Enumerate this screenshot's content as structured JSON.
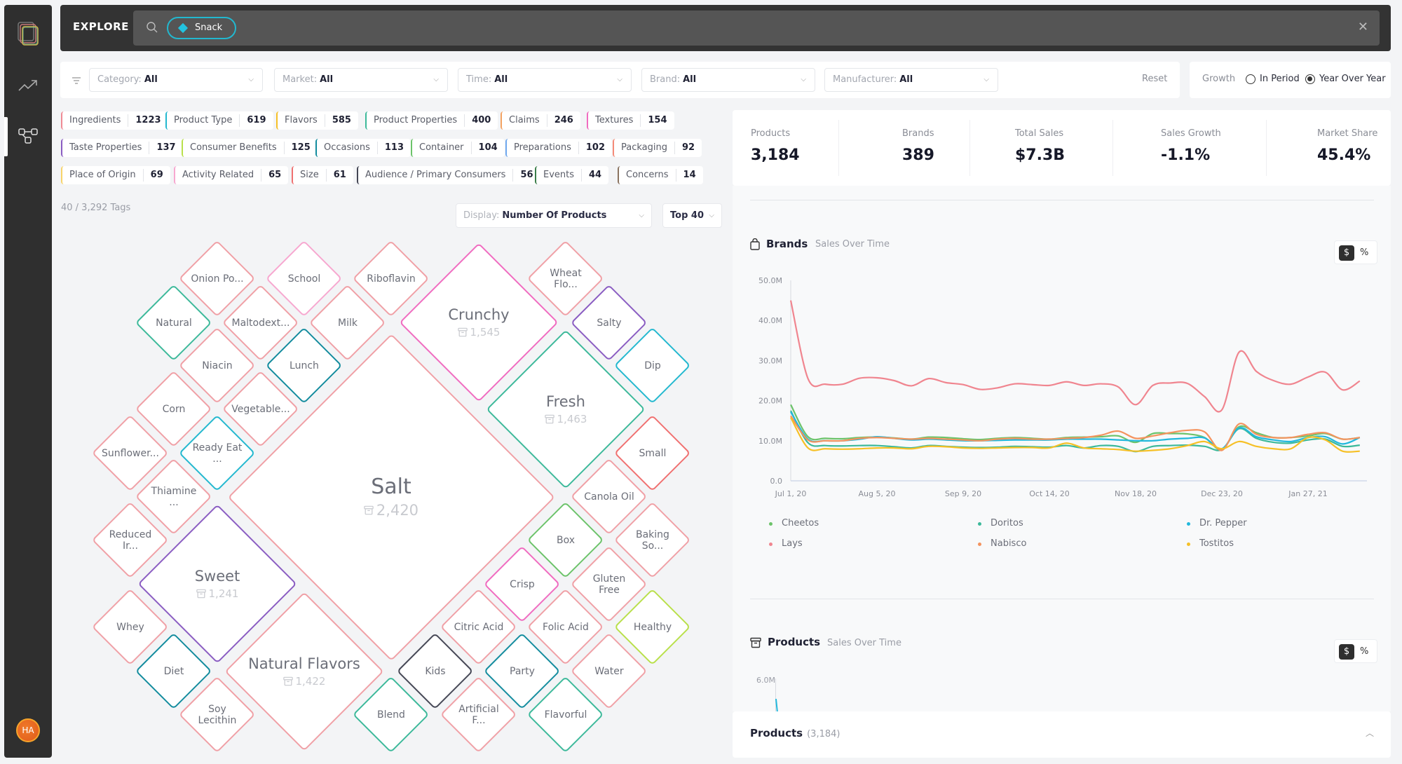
{
  "sidebar": {
    "items": [
      {
        "icon": "layers-logo-icon",
        "label": "Home"
      },
      {
        "icon": "trend-icon",
        "label": "Trends"
      },
      {
        "icon": "network-icon",
        "label": "Explore",
        "active": true
      }
    ],
    "avatar_initials": "HA"
  },
  "explore": {
    "title": "EXPLORE",
    "chip_label": "Snack",
    "close_icon": "close-icon"
  },
  "filters": {
    "selects": [
      {
        "label": "Category:",
        "value": "All"
      },
      {
        "label": "Market:",
        "value": "All"
      },
      {
        "label": "Time:",
        "value": "All"
      },
      {
        "label": "Brand:",
        "value": "All"
      },
      {
        "label": "Manufacturer:",
        "value": "All"
      }
    ],
    "reset_label": "Reset"
  },
  "growth": {
    "label": "Growth",
    "options": [
      {
        "label": "In Period",
        "selected": false
      },
      {
        "label": "Year Over Year",
        "selected": true
      }
    ]
  },
  "tag_categories": [
    {
      "name": "Ingredients",
      "count": "1223",
      "color": "#f08a94"
    },
    {
      "name": "Product Type",
      "count": "619",
      "color": "#22b8cf"
    },
    {
      "name": "Flavors",
      "count": "585",
      "color": "#f6c026"
    },
    {
      "name": "Product Properties",
      "count": "400",
      "color": "#3cb99a"
    },
    {
      "name": "Claims",
      "count": "246",
      "color": "#f4a261"
    },
    {
      "name": "Textures",
      "count": "154",
      "color": "#f06bc0"
    },
    {
      "name": "Taste Properties",
      "count": "137",
      "color": "#8a5cc2"
    },
    {
      "name": "Consumer Benefits",
      "count": "125",
      "color": "#b9e04a"
    },
    {
      "name": "Occasions",
      "count": "113",
      "color": "#138c9e"
    },
    {
      "name": "Container",
      "count": "104",
      "color": "#6cc36a"
    },
    {
      "name": "Preparations",
      "count": "102",
      "color": "#6fa8ee"
    },
    {
      "name": "Packaging",
      "count": "92",
      "color": "#f58b78"
    },
    {
      "name": "Place of Origin",
      "count": "69",
      "color": "#f8d46a"
    },
    {
      "name": "Activity Related",
      "count": "65",
      "color": "#f7a8d0"
    },
    {
      "name": "Size",
      "count": "61",
      "color": "#f07070"
    },
    {
      "name": "Audience / Primary Consumers",
      "count": "56",
      "color": "#444654"
    },
    {
      "name": "Events",
      "count": "44",
      "color": "#3a7d4a"
    },
    {
      "name": "Concerns",
      "count": "14",
      "color": "#8a7360"
    }
  ],
  "tag_counter": "40 / 3,292 Tags",
  "display": {
    "label": "Display:",
    "value": "Number Of Products"
  },
  "top": {
    "value": "Top 40"
  },
  "tags": [
    {
      "name": "Salt",
      "count": "2,420",
      "color": "#f0a0a6"
    },
    {
      "name": "Crunchy",
      "count": "1,545",
      "color": "#f06bc0"
    },
    {
      "name": "Fresh",
      "count": "1,463",
      "color": "#3cb99a"
    },
    {
      "name": "Natural Flavors",
      "count": "1,422",
      "color": "#f0a0a6"
    },
    {
      "name": "Sweet",
      "count": "1,241",
      "color": "#8a5cc2"
    },
    {
      "name": "Onion Po...",
      "color": "#f0a0a6"
    },
    {
      "name": "School",
      "color": "#f7a8d0"
    },
    {
      "name": "Riboflavin",
      "color": "#f0a0a6"
    },
    {
      "name": "Wheat Flo...",
      "color": "#f0a0a6"
    },
    {
      "name": "Natural",
      "color": "#3cb99a"
    },
    {
      "name": "Maltodext...",
      "color": "#f0a0a6"
    },
    {
      "name": "Milk",
      "color": "#f0a0a6"
    },
    {
      "name": "Salty",
      "color": "#8a5cc2"
    },
    {
      "name": "Niacin",
      "color": "#f0a0a6"
    },
    {
      "name": "Lunch",
      "color": "#138c9e"
    },
    {
      "name": "Dip",
      "color": "#22b8cf"
    },
    {
      "name": "Corn",
      "color": "#f0a0a6"
    },
    {
      "name": "Vegetable...",
      "color": "#f0a0a6"
    },
    {
      "name": "Sunflower...",
      "color": "#f0a0a6"
    },
    {
      "name": "Ready Eat ...",
      "color": "#22b8cf"
    },
    {
      "name": "Small",
      "color": "#f07070"
    },
    {
      "name": "Thiamine ...",
      "color": "#f0a0a6"
    },
    {
      "name": "Canola Oil",
      "color": "#f0a0a6"
    },
    {
      "name": "Reduced Ir...",
      "color": "#f0a0a6"
    },
    {
      "name": "Box",
      "color": "#6cc36a"
    },
    {
      "name": "Baking So...",
      "color": "#f0a0a6"
    },
    {
      "name": "Crisp",
      "color": "#f06bc0"
    },
    {
      "name": "Gluten Free",
      "color": "#f0a0a6"
    },
    {
      "name": "Whey",
      "color": "#f0a0a6"
    },
    {
      "name": "Citric Acid",
      "color": "#f0a0a6"
    },
    {
      "name": "Folic Acid",
      "color": "#f0a0a6"
    },
    {
      "name": "Healthy",
      "color": "#b9e04a"
    },
    {
      "name": "Diet",
      "color": "#138c9e"
    },
    {
      "name": "Kids",
      "color": "#444654"
    },
    {
      "name": "Party",
      "color": "#138c9e"
    },
    {
      "name": "Water",
      "color": "#f0a0a6"
    },
    {
      "name": "Soy Lecithin",
      "color": "#f0a0a6"
    },
    {
      "name": "Blend",
      "color": "#3cb99a"
    },
    {
      "name": "Artificial F...",
      "color": "#f0a0a6"
    },
    {
      "name": "Flavorful",
      "color": "#3cb99a"
    }
  ],
  "stats": [
    {
      "label": "Products",
      "value": "3,184"
    },
    {
      "label": "Brands",
      "value": "389"
    },
    {
      "label": "Total Sales",
      "value": "$7.3B"
    },
    {
      "label": "Sales Growth",
      "value": "-1.1%"
    },
    {
      "label": "Market Share",
      "value": "45.4%"
    }
  ],
  "brands_chart": {
    "title": "Brands",
    "subtitle": "Sales Over Time",
    "toggle": {
      "dollar": "$",
      "percent": "%",
      "selected": "$"
    }
  },
  "products_chart": {
    "title": "Products",
    "subtitle": "Sales Over Time",
    "toggle": {
      "dollar": "$",
      "percent": "%",
      "selected": "$"
    },
    "visible_ticks": [
      "6.0M"
    ]
  },
  "products_section": {
    "title": "Products",
    "count": "(3,184)"
  },
  "chart_data": {
    "type": "line",
    "title": "Brands Sales Over Time",
    "xlabel": "",
    "ylabel": "",
    "ylim": [
      0,
      50
    ],
    "y_unit": "M",
    "y_ticks": [
      "0.0",
      "10.0M",
      "20.0M",
      "30.0M",
      "40.0M",
      "50.0M"
    ],
    "x_ticks": [
      "Jul 1, 20",
      "Aug 5, 20",
      "Sep 9, 20",
      "Oct 14, 20",
      "Nov 18, 20",
      "Dec 23, 20",
      "Jan 27, 21"
    ],
    "x_interval": "weekly",
    "x_count": 34,
    "legend_position": "bottom",
    "grid": false,
    "series": [
      {
        "name": "Cheetos",
        "color": "#6cc36a",
        "values": [
          19,
          11,
          10.6,
          10.5,
          10.8,
          10.9,
          10.7,
          10.4,
          10.9,
          10.8,
          10.5,
          10.3,
          10.6,
          10.8,
          10.6,
          10.4,
          10.8,
          10.9,
          11.0,
          11.2,
          9.6,
          11.8,
          11.8,
          11.7,
          10.8,
          7.8,
          13.5,
          12.0,
          10.8,
          10.8,
          11.2,
          11.8,
          10.4,
          10.8
        ]
      },
      {
        "name": "Doritos",
        "color": "#3cb99a",
        "values": [
          17.5,
          9.5,
          8.8,
          8.7,
          8.8,
          8.8,
          8.5,
          8.2,
          8.8,
          8.6,
          8.4,
          8.3,
          8.4,
          8.6,
          8.5,
          8.4,
          8.8,
          8.2,
          8.8,
          8.6,
          7.3,
          8.6,
          8.8,
          8.9,
          8.6,
          7.8,
          13.0,
          10.6,
          9.6,
          9.4,
          10.2,
          10.4,
          8.6,
          8.9
        ]
      },
      {
        "name": "Dr. Pepper",
        "color": "#22b8dc",
        "values": [
          17.2,
          10.4,
          10.0,
          10.0,
          10.4,
          11.0,
          10.6,
          10.2,
          10.4,
          10.2,
          10.0,
          10.0,
          10.1,
          10.2,
          10.2,
          10.2,
          10.4,
          10.4,
          10.4,
          10.2,
          10.0,
          10.0,
          10.4,
          10.6,
          10.7,
          8.0,
          13.2,
          11.0,
          10.2,
          9.8,
          10.8,
          11.0,
          9.2,
          10.8
        ]
      },
      {
        "name": "Lays",
        "color": "#f0858f",
        "values": [
          45.0,
          25.5,
          24.1,
          24.1,
          25.6,
          25.7,
          25.0,
          23.7,
          25.5,
          24.5,
          24.0,
          22.8,
          23.2,
          24.2,
          24.0,
          23.8,
          24.7,
          23.8,
          24.2,
          23.4,
          19.0,
          23.8,
          24.4,
          24.3,
          21.0,
          17.7,
          32.1,
          27.3,
          25.0,
          24.1,
          25.9,
          27.1,
          22.7,
          24.9
        ]
      },
      {
        "name": "Nabisco",
        "color": "#f4935e",
        "values": [
          16.2,
          10.2,
          10.0,
          10.0,
          10.6,
          10.8,
          10.6,
          10.4,
          10.6,
          10.4,
          10.2,
          10.0,
          10.4,
          10.6,
          10.4,
          10.4,
          10.6,
          10.8,
          11.4,
          12.4,
          10.6,
          11.2,
          12.0,
          12.6,
          12.2,
          7.6,
          14.2,
          11.6,
          10.8,
          10.8,
          11.6,
          12.0,
          10.4,
          10.8
        ]
      },
      {
        "name": "Tostitos",
        "color": "#f6c026",
        "values": [
          15.8,
          8.2,
          8.0,
          7.9,
          8.0,
          8.2,
          8.2,
          8.0,
          8.6,
          8.5,
          8.2,
          8.1,
          8.2,
          8.3,
          8.3,
          8.2,
          9.4,
          8.2,
          8.0,
          7.8,
          7.4,
          7.6,
          8.0,
          8.8,
          9.8,
          8.0,
          9.8,
          8.6,
          8.0,
          8.0,
          10.8,
          10.2,
          7.4,
          7.4
        ]
      }
    ]
  }
}
